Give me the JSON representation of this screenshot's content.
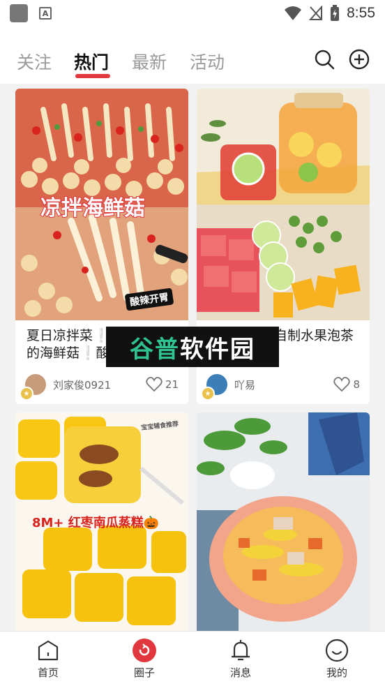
{
  "status_bar": {
    "time": "8:55",
    "icons": [
      "app-icon",
      "a-icon",
      "wifi-icon",
      "no-signal-icon",
      "battery-charging-icon"
    ]
  },
  "header": {
    "tabs": [
      {
        "label": "关注",
        "active": false
      },
      {
        "label": "热门",
        "active": true
      },
      {
        "label": "最新",
        "active": false
      },
      {
        "label": "活动",
        "active": false
      }
    ],
    "icons": [
      "search-icon",
      "add-icon"
    ],
    "accent_color": "#e0383e"
  },
  "feed": {
    "cards": [
      {
        "image_text": "凉拌海鲜菇",
        "image_badge": "酸辣开胃",
        "title": "夏日凉拌菜❕❕好吃到爆的海鲜菇❕酸辣开胃解馋",
        "author": "刘家俊0921",
        "likes": "21"
      },
      {
        "title": "夏天就要喝自制水果泡茶夏天必",
        "author": "吖易",
        "likes": "8"
      },
      {
        "image_text": "8M+ 红枣南瓜蒸糕🎃",
        "image_note": "宝宝辅食推荐"
      },
      {
        "image_text": ""
      }
    ]
  },
  "watermark": {
    "part1": "谷普",
    "part2": "软件园"
  },
  "bottom_nav": {
    "items": [
      {
        "label": "首页",
        "icon": "home-icon",
        "active": false
      },
      {
        "label": "圈子",
        "icon": "circle-icon",
        "active": true
      },
      {
        "label": "消息",
        "icon": "bell-icon",
        "active": false
      },
      {
        "label": "我的",
        "icon": "smile-icon",
        "active": false
      }
    ]
  }
}
